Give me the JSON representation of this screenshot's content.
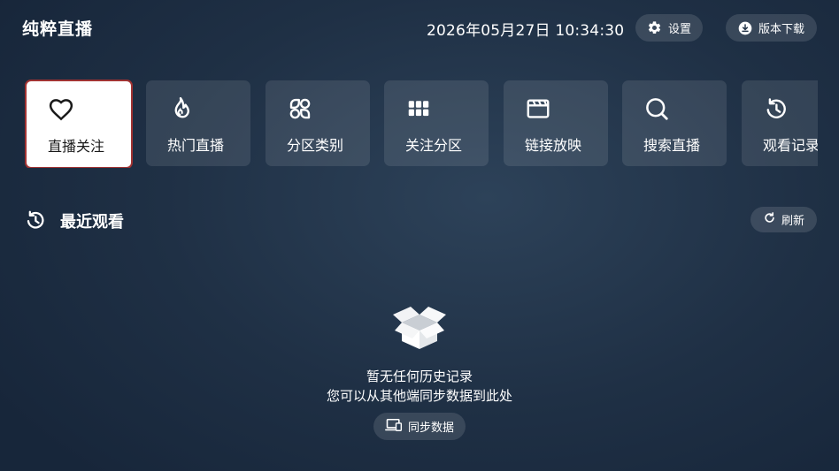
{
  "header": {
    "app_title": "纯粹直播",
    "datetime": "2026年05月27日 10:34:30",
    "settings_label": "设置",
    "download_label": "版本下载"
  },
  "menu": {
    "items": [
      {
        "label": "直播关注",
        "icon": "heart-icon",
        "active": true
      },
      {
        "label": "热门直播",
        "icon": "flame-icon",
        "active": false
      },
      {
        "label": "分区类别",
        "icon": "category-icon",
        "active": false
      },
      {
        "label": "关注分区",
        "icon": "grid-icon",
        "active": false
      },
      {
        "label": "链接放映",
        "icon": "clapperboard-icon",
        "active": false
      },
      {
        "label": "搜索直播",
        "icon": "search-icon",
        "active": false
      },
      {
        "label": "观看记录",
        "icon": "history-icon",
        "active": false
      }
    ]
  },
  "recent": {
    "title": "最近观看",
    "refresh_label": "刷新",
    "empty_line1": "暂无任何历史记录",
    "empty_line2": "您可以从其他端同步数据到此处",
    "sync_label": "同步数据"
  },
  "colors": {
    "active_border": "#a03232",
    "active_bg": "#ffffff"
  }
}
